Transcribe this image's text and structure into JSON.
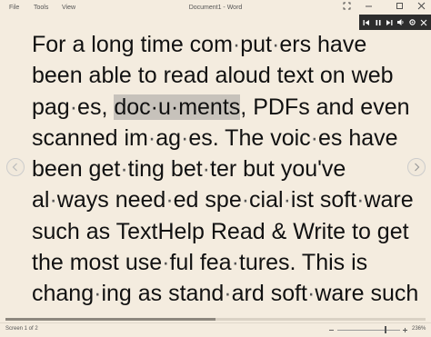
{
  "titlebar": {
    "menu": [
      "File",
      "Tools",
      "View"
    ],
    "title": "Document1 - Word"
  },
  "read_aloud": {
    "buttons": [
      "previous-icon",
      "pause-icon",
      "next-icon",
      "speaker-icon",
      "settings-icon",
      "close-icon"
    ]
  },
  "document": {
    "lines": [
      [
        {
          "t": "For a long time com"
        },
        {
          "t": "·",
          "h": true
        },
        {
          "t": "put"
        },
        {
          "t": "·",
          "h": true
        },
        {
          "t": "ers have"
        }
      ],
      [
        {
          "t": "been able to read aloud text on web"
        }
      ],
      [
        {
          "t": "pag"
        },
        {
          "t": "·",
          "h": true
        },
        {
          "t": "es, "
        },
        {
          "t": "doc·u·ments",
          "hl": true
        },
        {
          "t": ", PDFs and even"
        }
      ],
      [
        {
          "t": "scanned im"
        },
        {
          "t": "·",
          "h": true
        },
        {
          "t": "ag"
        },
        {
          "t": "·",
          "h": true
        },
        {
          "t": "es. The voic"
        },
        {
          "t": "·",
          "h": true
        },
        {
          "t": "es have"
        }
      ],
      [
        {
          "t": "been get"
        },
        {
          "t": "·",
          "h": true
        },
        {
          "t": "ting bet"
        },
        {
          "t": "·",
          "h": true
        },
        {
          "t": "ter but you've"
        }
      ],
      [
        {
          "t": "al"
        },
        {
          "t": "·",
          "h": true
        },
        {
          "t": "ways need"
        },
        {
          "t": "·",
          "h": true
        },
        {
          "t": "ed spe"
        },
        {
          "t": "·",
          "h": true
        },
        {
          "t": "cial"
        },
        {
          "t": "·",
          "h": true
        },
        {
          "t": "ist soft"
        },
        {
          "t": "·",
          "h": true
        },
        {
          "t": "ware"
        }
      ],
      [
        {
          "t": "such as TextHelp Read & Write to get"
        }
      ],
      [
        {
          "t": "the most use"
        },
        {
          "t": "·",
          "h": true
        },
        {
          "t": "ful fea"
        },
        {
          "t": "·",
          "h": true
        },
        {
          "t": "tures. This is"
        }
      ],
      [
        {
          "t": "chang"
        },
        {
          "t": "·",
          "h": true
        },
        {
          "t": "ing as stand"
        },
        {
          "t": "·",
          "h": true
        },
        {
          "t": "ard soft"
        },
        {
          "t": "·",
          "h": true
        },
        {
          "t": "ware such"
        }
      ]
    ]
  },
  "status": {
    "page": "Screen 1 of 2",
    "zoom": "236%",
    "scroll_fraction": 0.5
  }
}
